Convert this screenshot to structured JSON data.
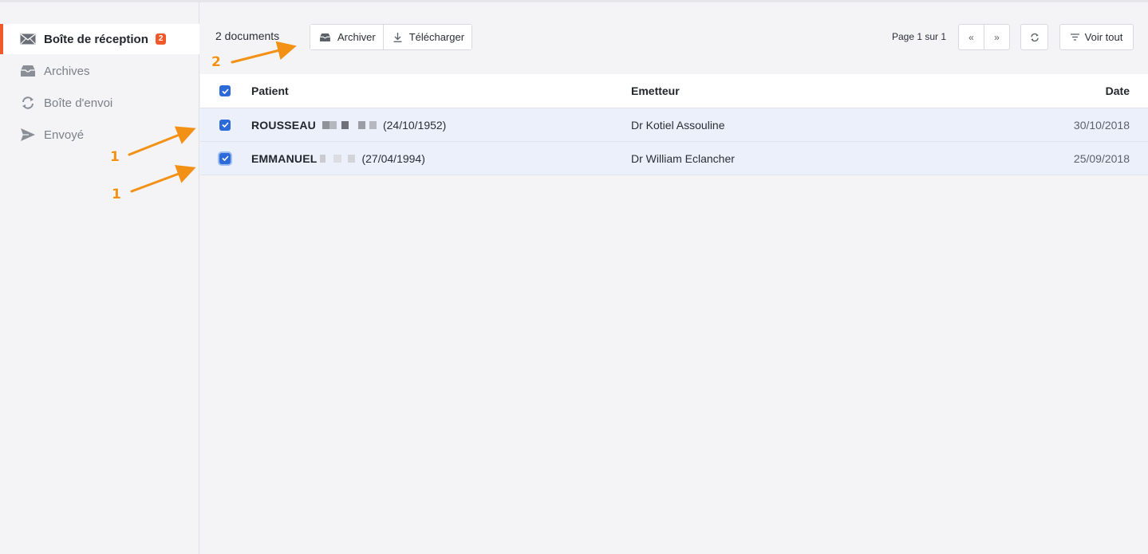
{
  "sidebar": {
    "items": [
      {
        "label": "Boîte de réception",
        "icon": "envelope-icon",
        "badge": "2",
        "active": true
      },
      {
        "label": "Archives",
        "icon": "inbox-tray-icon"
      },
      {
        "label": "Boîte d'envoi",
        "icon": "sync-icon"
      },
      {
        "label": "Envoyé",
        "icon": "paper-plane-icon"
      }
    ]
  },
  "toolbar": {
    "count_label": "2 documents",
    "archive_label": "Archiver",
    "download_label": "Télécharger",
    "page_label": "Page 1 sur 1",
    "prev_label": "«",
    "next_label": "»",
    "voir_tout_label": "Voir tout"
  },
  "table": {
    "headers": {
      "patient": "Patient",
      "emetteur": "Emetteur",
      "date": "Date"
    },
    "rows": [
      {
        "name": "ROUSSEAU",
        "dob": "(24/10/1952)",
        "emetteur": "Dr Kotiel Assouline",
        "date": "30/10/2018",
        "checked": true
      },
      {
        "name": "EMMANUEL",
        "dob": "(27/04/1994)",
        "emetteur": "Dr William Eclancher",
        "date": "25/09/2018",
        "checked": true
      }
    ]
  },
  "annotations": {
    "label_1": "1",
    "label_2": "2",
    "arrow_color": "#f39016"
  },
  "colors": {
    "accent": "#f0592b",
    "checkbox": "#2c69d9",
    "selected_row": "#ebf0fb"
  }
}
